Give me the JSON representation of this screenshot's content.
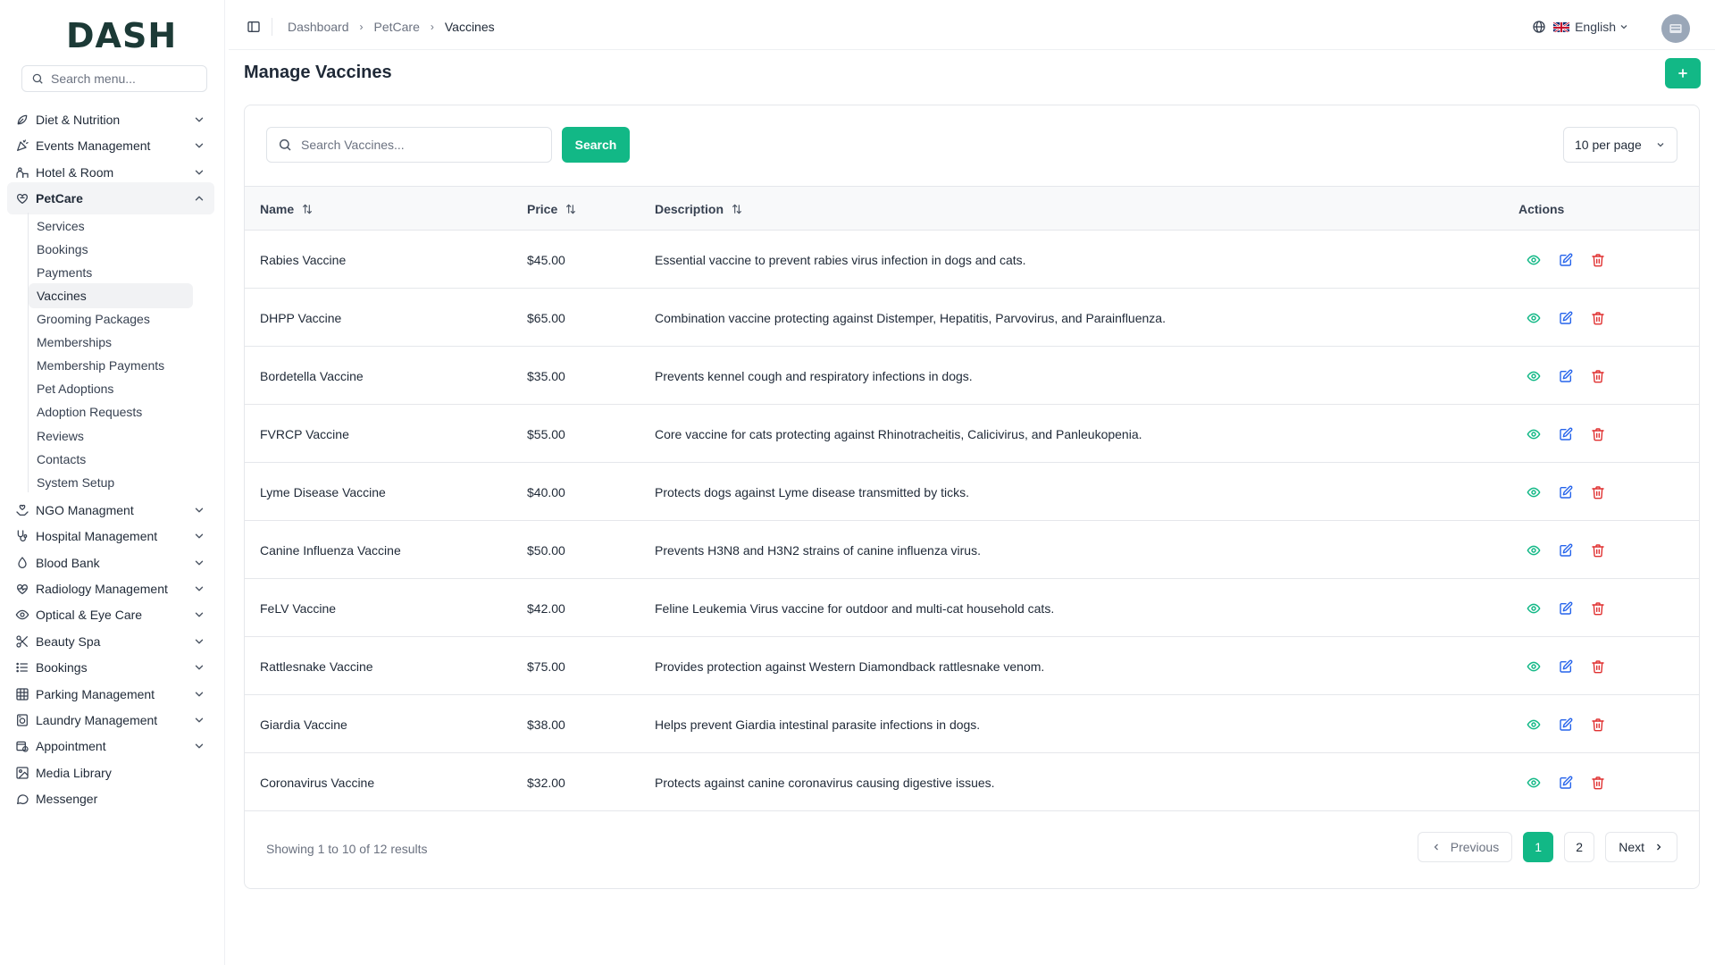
{
  "brand": {
    "logo_text": "DASH"
  },
  "sidebar": {
    "search_placeholder": "Search menu...",
    "items": [
      {
        "label": "Diet & Nutrition",
        "icon": "leaf-icon",
        "expanded": false
      },
      {
        "label": "Events Management",
        "icon": "party-icon",
        "expanded": false
      },
      {
        "label": "Hotel & Room",
        "icon": "hotel-icon",
        "expanded": false
      },
      {
        "label": "PetCare",
        "icon": "paw-heart-icon",
        "expanded": true
      },
      {
        "label": "NGO Managment",
        "icon": "hands-heart-icon",
        "expanded": false
      },
      {
        "label": "Hospital Management",
        "icon": "stethoscope-icon",
        "expanded": false
      },
      {
        "label": "Blood Bank",
        "icon": "blood-drop-icon",
        "expanded": false
      },
      {
        "label": "Radiology Management",
        "icon": "heart-pulse-icon",
        "expanded": false
      },
      {
        "label": "Optical & Eye Care",
        "icon": "eye-icon",
        "expanded": false
      },
      {
        "label": "Beauty Spa",
        "icon": "scissors-icon",
        "expanded": false
      },
      {
        "label": "Bookings",
        "icon": "list-icon",
        "expanded": false
      },
      {
        "label": "Parking Management",
        "icon": "grid-icon",
        "expanded": false
      },
      {
        "label": "Laundry Management",
        "icon": "washing-machine-icon",
        "expanded": false
      },
      {
        "label": "Appointment",
        "icon": "calendar-clock-icon",
        "expanded": false
      },
      {
        "label": "Media Library",
        "icon": "image-icon",
        "expanded": null
      },
      {
        "label": "Messenger",
        "icon": "chat-icon",
        "expanded": null
      }
    ],
    "petcare_sub": [
      "Services",
      "Bookings",
      "Payments",
      "Vaccines",
      "Grooming Packages",
      "Memberships",
      "Membership Payments",
      "Pet Adoptions",
      "Adoption Requests",
      "Reviews",
      "Contacts",
      "System Setup"
    ],
    "active_sub": "Vaccines"
  },
  "topbar": {
    "breadcrumbs": [
      "Dashboard",
      "PetCare",
      "Vaccines"
    ],
    "language": "English"
  },
  "page": {
    "title": "Manage Vaccines",
    "add_button": "+",
    "search_placeholder": "Search Vaccines...",
    "search_button": "Search",
    "per_page": "10 per page"
  },
  "table": {
    "columns": [
      "Name",
      "Price",
      "Description",
      "Actions"
    ],
    "rows": [
      {
        "name": "Rabies Vaccine",
        "price": "$45.00",
        "description": "Essential vaccine to prevent rabies virus infection in dogs and cats."
      },
      {
        "name": "DHPP Vaccine",
        "price": "$65.00",
        "description": "Combination vaccine protecting against Distemper, Hepatitis, Parvovirus, and Parainfluenza."
      },
      {
        "name": "Bordetella Vaccine",
        "price": "$35.00",
        "description": "Prevents kennel cough and respiratory infections in dogs."
      },
      {
        "name": "FVRCP Vaccine",
        "price": "$55.00",
        "description": "Core vaccine for cats protecting against Rhinotracheitis, Calicivirus, and Panleukopenia."
      },
      {
        "name": "Lyme Disease Vaccine",
        "price": "$40.00",
        "description": "Protects dogs against Lyme disease transmitted by ticks."
      },
      {
        "name": "Canine Influenza Vaccine",
        "price": "$50.00",
        "description": "Prevents H3N8 and H3N2 strains of canine influenza virus."
      },
      {
        "name": "FeLV Vaccine",
        "price": "$42.00",
        "description": "Feline Leukemia Virus vaccine for outdoor and multi-cat household cats."
      },
      {
        "name": "Rattlesnake Vaccine",
        "price": "$75.00",
        "description": "Provides protection against Western Diamondback rattlesnake venom."
      },
      {
        "name": "Giardia Vaccine",
        "price": "$38.00",
        "description": "Helps prevent Giardia intestinal parasite infections in dogs."
      },
      {
        "name": "Coronavirus Vaccine",
        "price": "$32.00",
        "description": "Protects against canine coronavirus causing digestive issues."
      }
    ]
  },
  "pagination": {
    "summary": "Showing 1 to 10 of 12 results",
    "previous": "Previous",
    "next": "Next",
    "pages": [
      "1",
      "2"
    ],
    "current": "1"
  },
  "colors": {
    "primary": "#12b886",
    "view": "#12b886",
    "edit": "#2563eb",
    "delete": "#e03131"
  }
}
